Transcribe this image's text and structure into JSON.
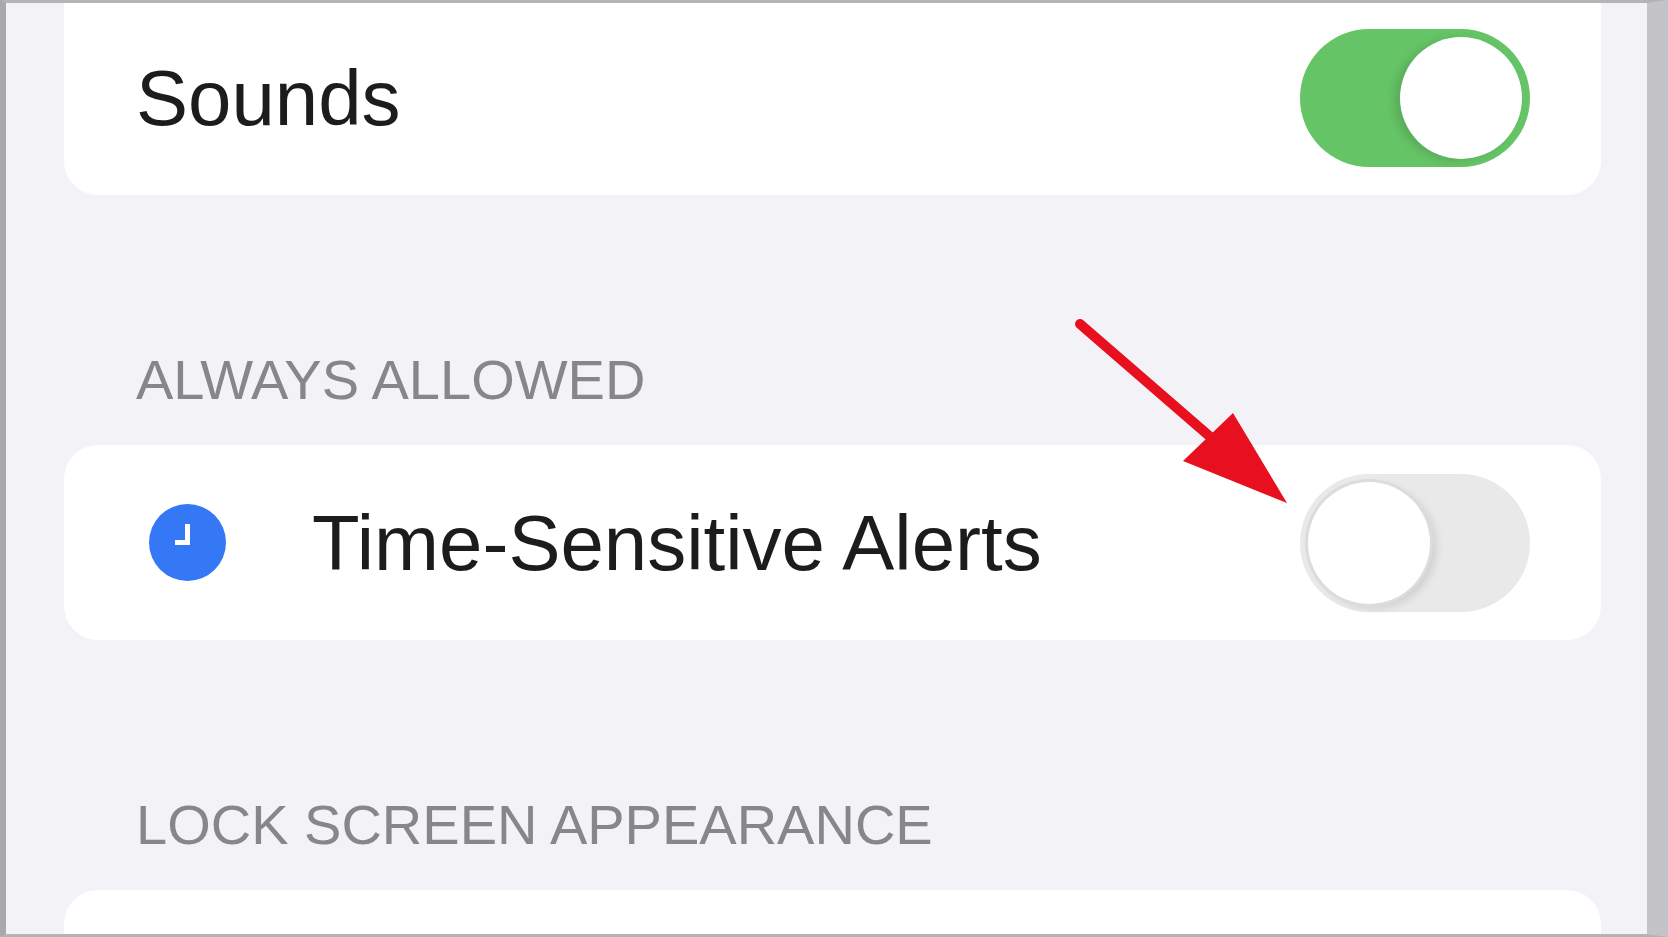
{
  "sections": [
    {
      "rows": [
        {
          "kind": "toggle",
          "label": "Sounds",
          "on": true,
          "annotated": false
        }
      ]
    },
    {
      "header": "ALWAYS ALLOWED",
      "rows": [
        {
          "kind": "icon-toggle",
          "label": "Time-Sensitive Alerts",
          "on": false,
          "annotated": true
        }
      ]
    },
    {
      "header": "LOCK SCREEN APPEARANCE"
    }
  ]
}
